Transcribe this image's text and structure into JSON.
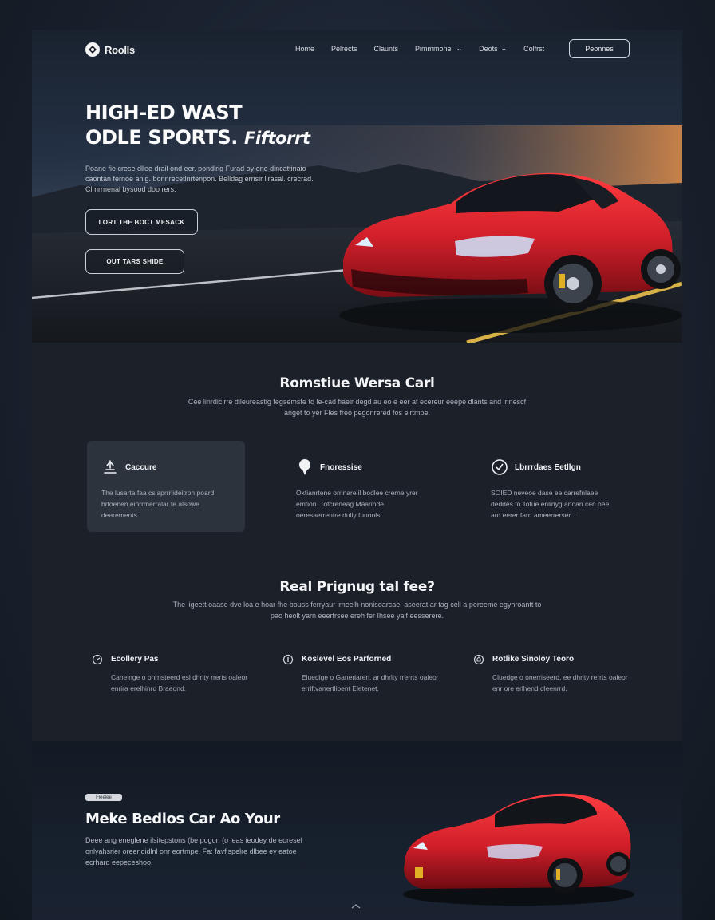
{
  "nav": {
    "logo_text": "Roolls",
    "links": [
      {
        "label": "Home",
        "has_caret": false
      },
      {
        "label": "Pelrects",
        "has_caret": false
      },
      {
        "label": "Claunts",
        "has_caret": false
      },
      {
        "label": "Pimmmonel",
        "has_caret": true
      },
      {
        "label": "Deots",
        "has_caret": true
      },
      {
        "label": "Colfrst",
        "has_caret": false
      }
    ],
    "cta_label": "Peonnes"
  },
  "hero": {
    "title_line1": "HIGH-ED WAST",
    "title_line2": "ODLE SPORTS.",
    "title_script": "Fiftorrt",
    "description": "Poane fie crese dllee drail ond eer. pondlrig Furad oy ene dincattinaio caontan fernoe anig. bonnrecetlnrtenpon. Belldag ernsir lirasal. crecrad. Clmrrnenal bysood doo rers.",
    "primary_button": "LORT THE BOCT MESACK",
    "secondary_button": "OUT TARS SHIDE"
  },
  "section1": {
    "title": "Romstiue Wersa Carl",
    "subtitle": "Cee linrdiclrre dileureastig fegsemsfe to le-cad fiaeir degd au eo e eer af ecereur eeepe dlants and lrinescf anget to yer Fles freo pegonrered fos eirtmpe.",
    "features": [
      {
        "icon": "performance-icon",
        "title": "Caccure",
        "text": "The lusarta faa cslaprrrlideitron poard brtoenen einrrmerralar fe alsowe dearements."
      },
      {
        "icon": "location-pin-icon",
        "title": "Fnoressise",
        "text": "Oxtianrtene orrinarelil bodlee crerne yrer emtion. Tofcreneag Maarinde oeresaerrentre dully funnols."
      },
      {
        "icon": "checkmark-badge-icon",
        "title": "Lbrrrdaes Eetllgn",
        "text": "SOIED neveoe dase ee carrefnlaee deddes to Tofue enlinyg anoan cen oee ard eerer farn ameerrerser..."
      }
    ]
  },
  "section2": {
    "title": "Real Prignug tal fee?",
    "subtitle": "The ligeett oaase dve loa e hoar fhe bouss ferryaur irneelh nonisoarcae, aseerat ar tag cell a pereeme egyhroantt to pao heolt yarn eeerfrsee ereh fer Ihsee yalf eesserere.",
    "items": [
      {
        "icon": "gauge-icon",
        "title": "Ecollery Pas",
        "text": "Caneinge o onrnsteerd esl dhrlty rrerts oaleor enrira erelhinrd Braeond."
      },
      {
        "icon": "info-icon",
        "title": "Koslevel Eos Parforned",
        "text": "Eluedige o Ganeriaren, ar dhrlty rrerrts oaleor erriftvanertlibent Eletenet."
      },
      {
        "icon": "shield-icon",
        "title": "Rotlike Sinoloy Teoro",
        "text": "Cluedge o onerriseerd, ee dhrlty rerrts oaleor enr ore erlhend dleenrrd."
      }
    ]
  },
  "promo": {
    "tag": "Fleelee",
    "title": "Meke Bedios Car Ao Your",
    "description": "Deee ang eneglene ilsitepstons (be pogon (o leas ieodey de eoresel onlyahsrier oreenoidlnl onr eortmpe. Fa: favfispelre dlbee ey eatoe ecrhard eepeceshoo."
  },
  "colors": {
    "accent_red": "#d3202b",
    "background": "#1b2029",
    "card_highlight": "#2d333d"
  }
}
